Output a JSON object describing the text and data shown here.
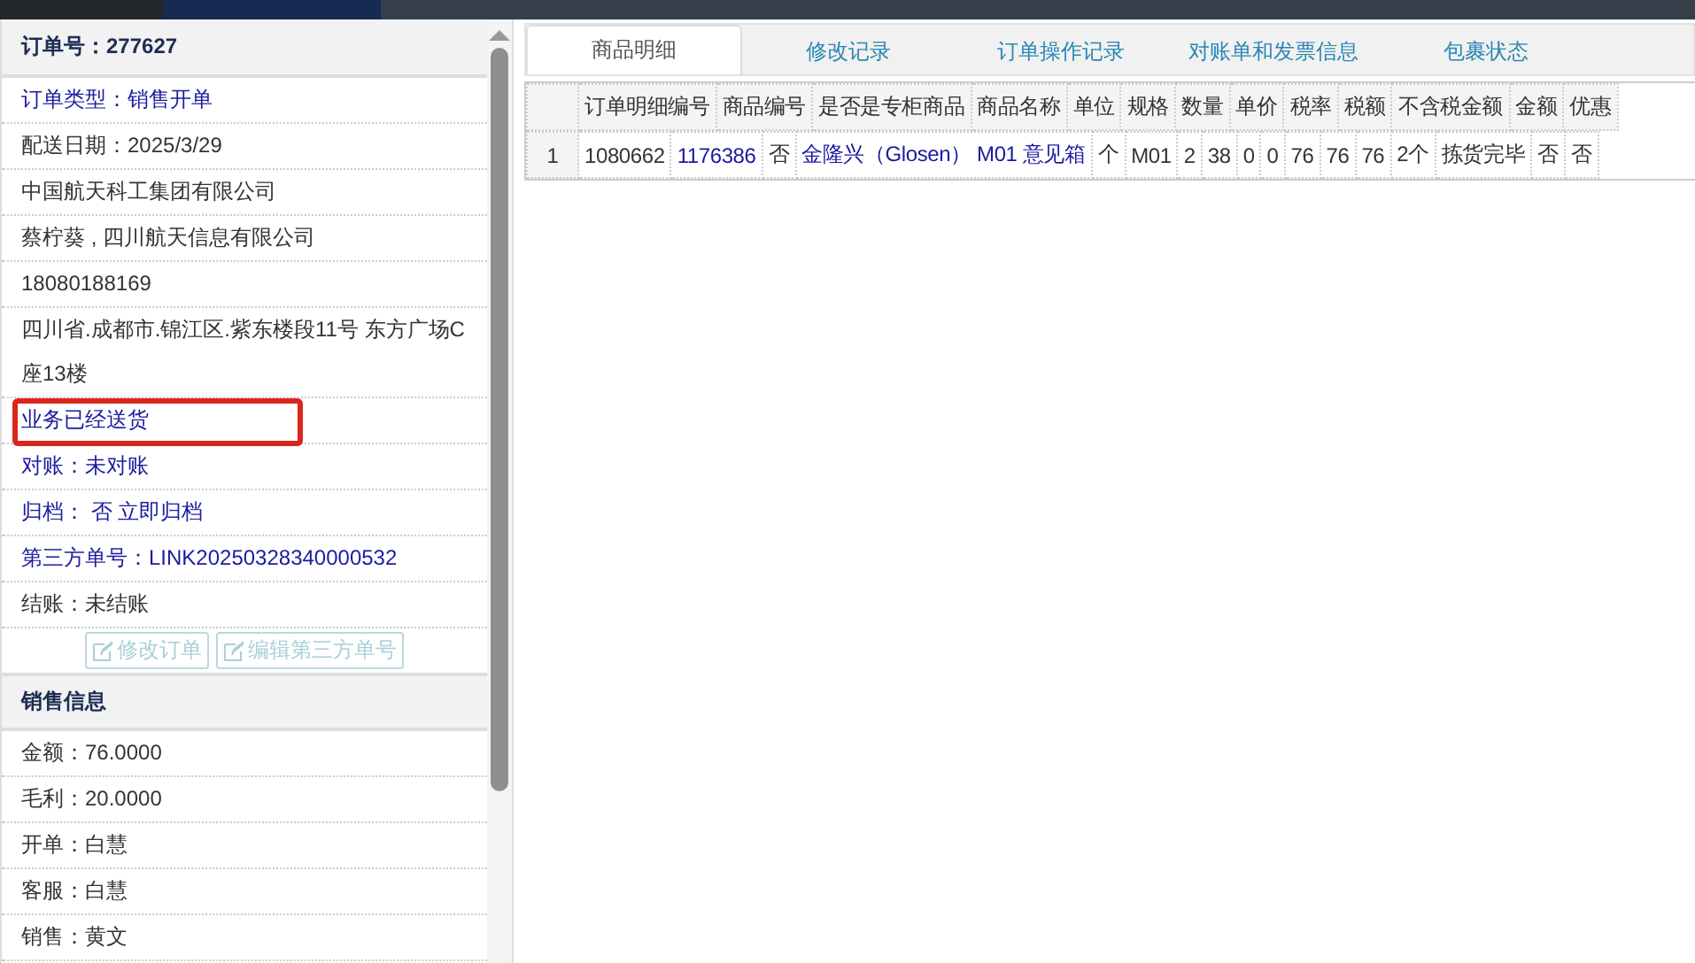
{
  "order_panel": {
    "title": "订单号：277627",
    "rows": [
      {
        "text": "订单类型：销售开单",
        "kind": "link",
        "highlighted": false
      },
      {
        "text": "配送日期：2025/3/29",
        "kind": "text",
        "highlighted": false
      },
      {
        "text": "中国航天科工集团有限公司",
        "kind": "text",
        "highlighted": false
      },
      {
        "text": "蔡柠葵 , 四川航天信息有限公司",
        "kind": "text",
        "highlighted": false
      },
      {
        "text": "18080188169",
        "kind": "text",
        "highlighted": false
      },
      {
        "text": "四川省.成都市.锦江区.紫东楼段11号 东方广场C座13楼",
        "kind": "text",
        "highlighted": false
      },
      {
        "text": "业务已经送货",
        "kind": "link",
        "highlighted": true
      },
      {
        "text": "对账：未对账",
        "kind": "link",
        "highlighted": false
      },
      {
        "text": "归档： 否 立即归档",
        "kind": "link",
        "highlighted": false
      },
      {
        "text": "第三方单号：LINK20250328340000532",
        "kind": "link",
        "highlighted": false
      },
      {
        "text": "结账：未结账",
        "kind": "text",
        "highlighted": false
      }
    ],
    "buttons": [
      {
        "label": "修改订单",
        "disabled": true
      },
      {
        "label": "编辑第三方单号",
        "disabled": true
      }
    ]
  },
  "sales_panel": {
    "title": "销售信息",
    "rows": [
      "金额：76.0000",
      "毛利：20.0000",
      "开单：白慧",
      "客服：白慧",
      "销售：黄文"
    ]
  },
  "tabs": [
    {
      "label": "商品明细",
      "selected": true
    },
    {
      "label": "修改记录",
      "selected": false
    },
    {
      "label": "订单操作记录",
      "selected": false
    },
    {
      "label": "对账单和发票信息",
      "selected": false
    },
    {
      "label": "包裹状态",
      "selected": false
    }
  ],
  "table": {
    "header_strip": [
      "订单明细编号",
      "商品编号",
      "是否是专柜商品",
      "商品名称",
      "单位",
      "规格",
      "数量",
      "单价",
      "税率",
      "税额",
      "不含税金额",
      "金额",
      "优惠"
    ],
    "item_strips": [
      {
        "number": "1",
        "cells": [
          {
            "text": "1080662",
            "kind": "text"
          },
          {
            "text": "1176386",
            "kind": "link"
          },
          {
            "text": "否",
            "kind": "text"
          },
          {
            "text": "金隆兴（Glosen） M01 意见箱",
            "kind": "link"
          },
          {
            "text": "个",
            "kind": "text"
          },
          {
            "text": "M01",
            "kind": "text"
          },
          {
            "text": "2",
            "kind": "text"
          },
          {
            "text": "38",
            "kind": "text"
          },
          {
            "text": "0",
            "kind": "text"
          },
          {
            "text": "0",
            "kind": "text"
          },
          {
            "text": "76",
            "kind": "text"
          },
          {
            "text": "76",
            "kind": "text"
          },
          {
            "text": "76",
            "kind": "text"
          },
          {
            "text": "2个",
            "kind": "text"
          },
          {
            "text": "拣货完毕",
            "kind": "text"
          },
          {
            "text": "否",
            "kind": "text"
          },
          {
            "text": "否",
            "kind": "text"
          }
        ]
      }
    ]
  }
}
